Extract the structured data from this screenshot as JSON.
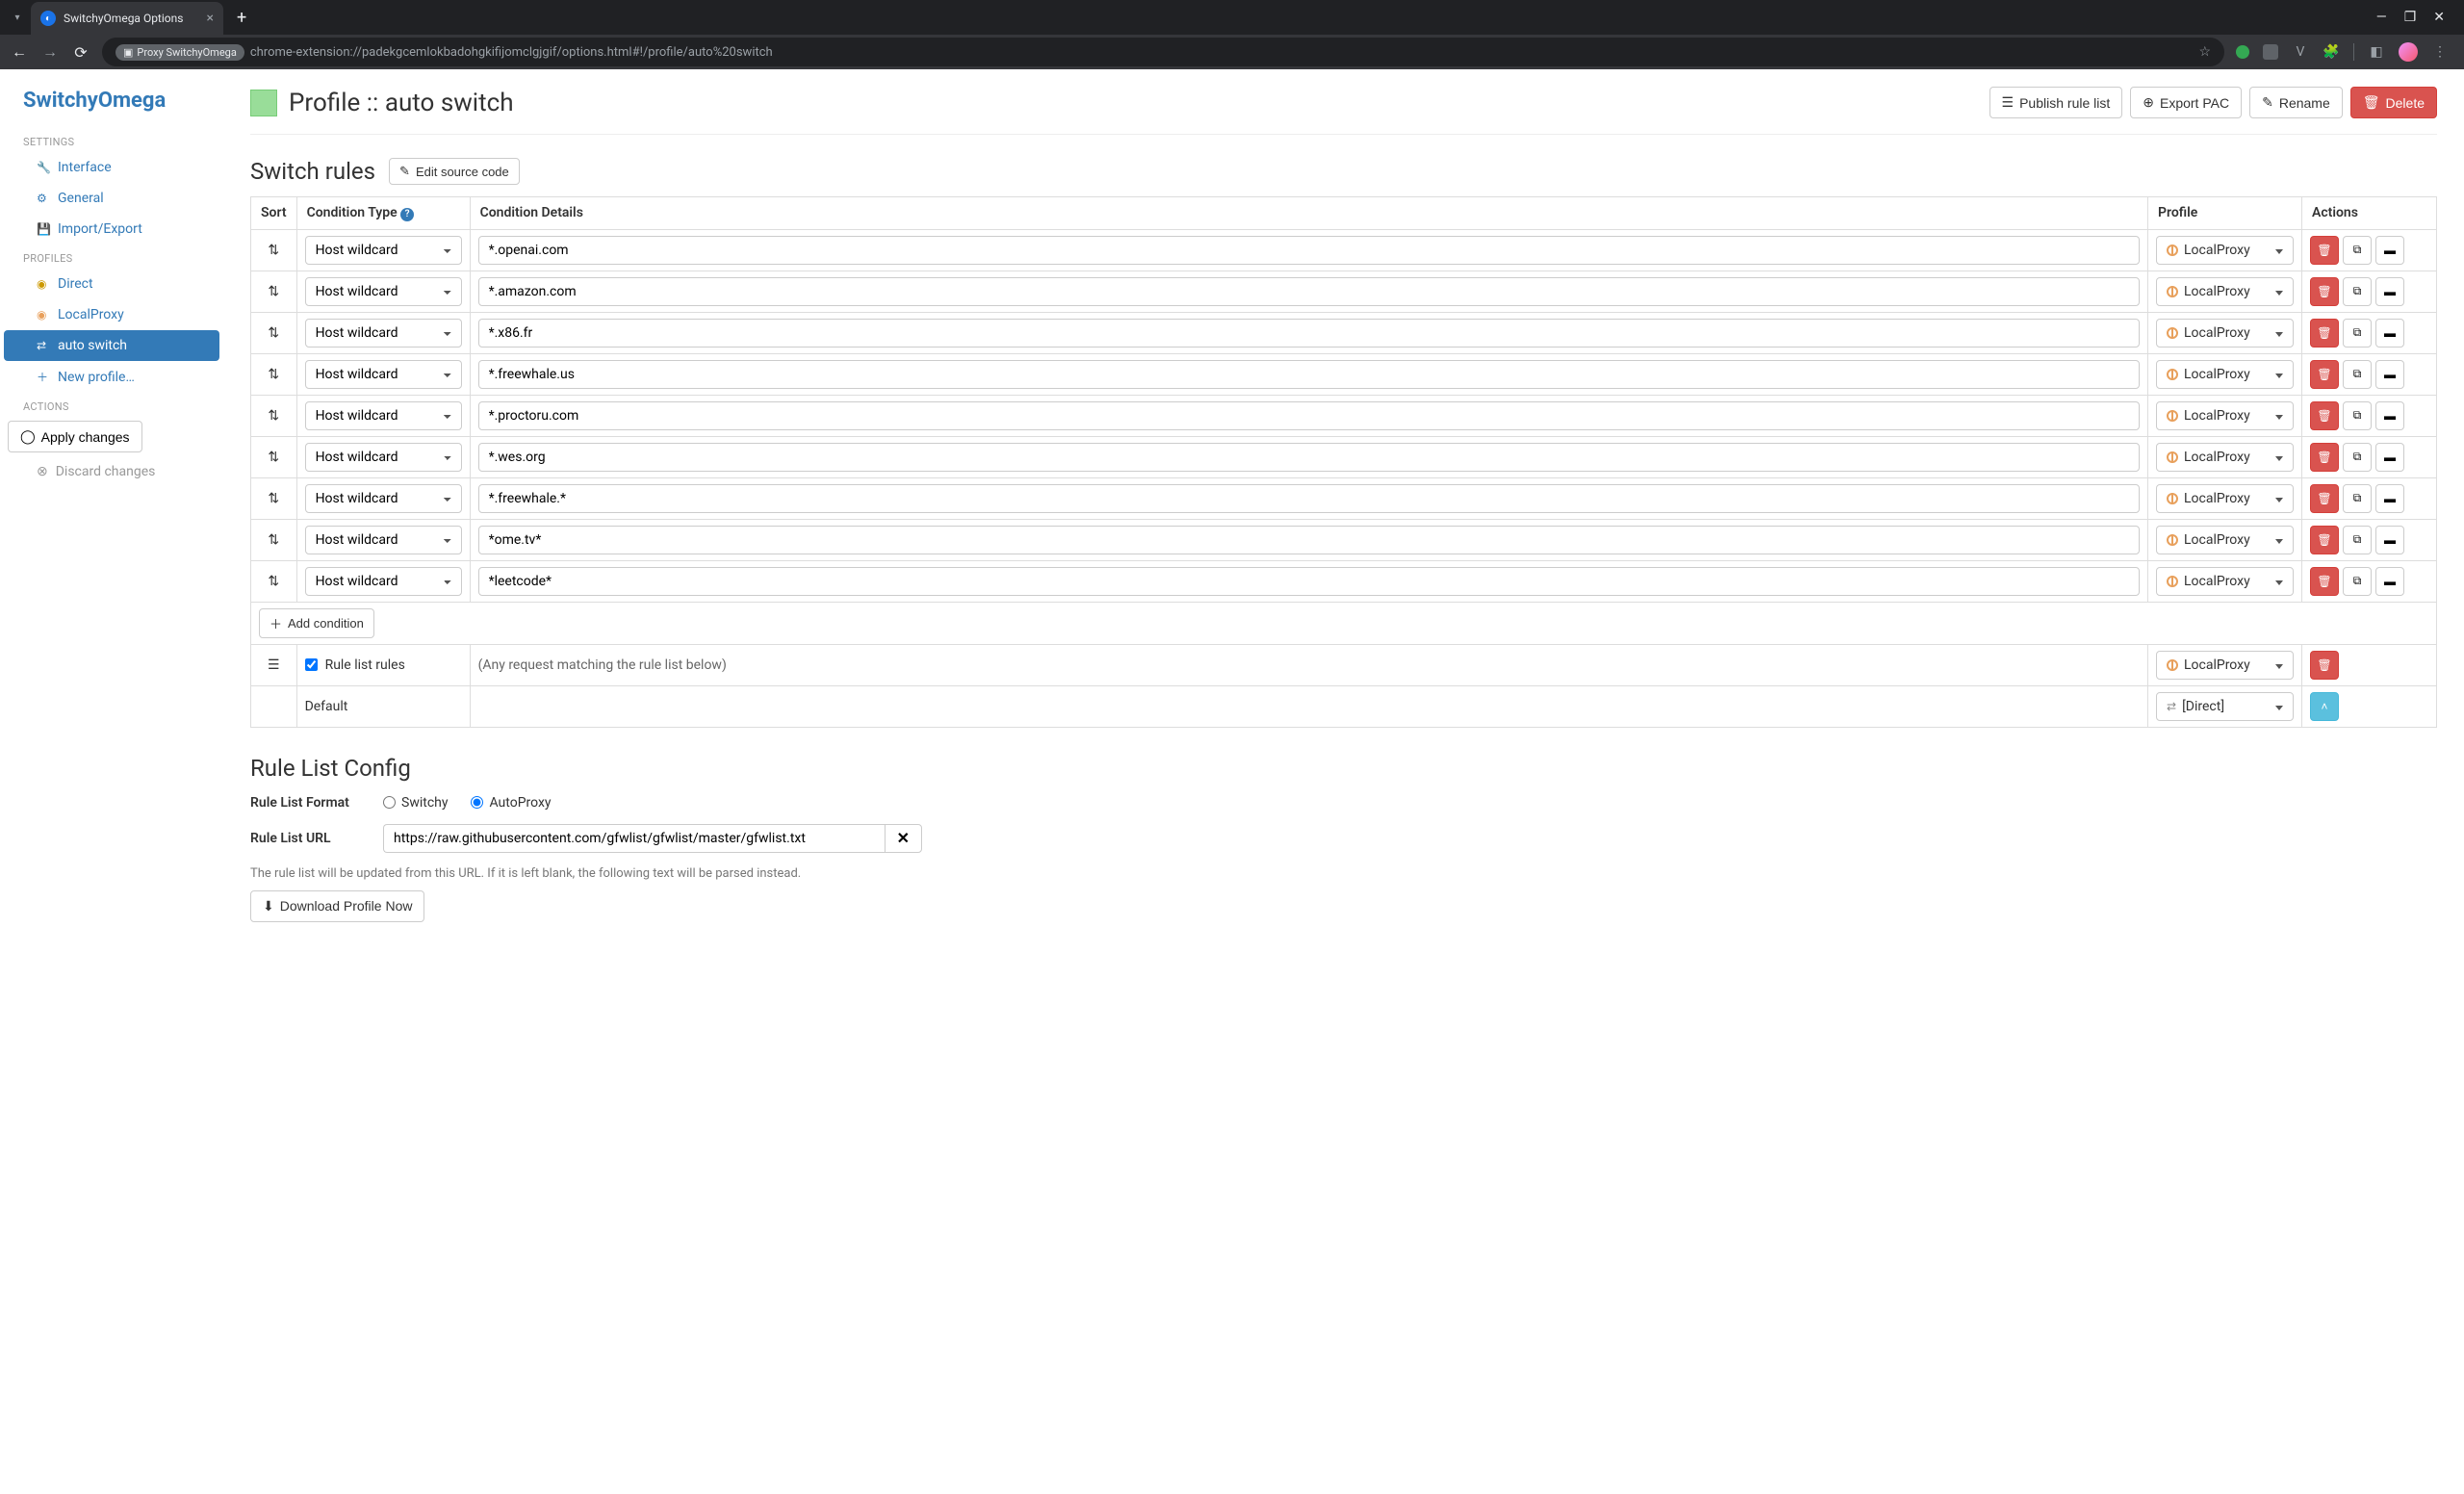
{
  "browser": {
    "tab_title": "SwitchyOmega Options",
    "badge": "Proxy SwitchyOmega",
    "url": "chrome-extension://padekgcemlokbadohgkifijomclgjgif/options.html#!/profile/auto%20switch"
  },
  "brand": "SwitchyOmega",
  "sidebar": {
    "headers": {
      "settings": "SETTINGS",
      "profiles": "PROFILES",
      "actions": "ACTIONS"
    },
    "settings": [
      {
        "label": "Interface"
      },
      {
        "label": "General"
      },
      {
        "label": "Import/Export"
      }
    ],
    "profiles": [
      {
        "label": "Direct"
      },
      {
        "label": "LocalProxy"
      },
      {
        "label": "auto switch",
        "active": true
      }
    ],
    "new_profile": "New profile…",
    "apply": "Apply changes",
    "discard": "Discard changes"
  },
  "profile": {
    "title_prefix": "Profile :: ",
    "name": "auto switch",
    "actions": {
      "publish": "Publish rule list",
      "export": "Export PAC",
      "rename": "Rename",
      "delete": "Delete"
    }
  },
  "switch_rules": {
    "title": "Switch rules",
    "edit_source": "Edit source code",
    "columns": {
      "sort": "Sort",
      "type": "Condition Type",
      "details": "Condition Details",
      "profile": "Profile",
      "actions": "Actions"
    },
    "condition_type": "Host wildcard",
    "rules": [
      {
        "details": "*.openai.com",
        "profile": "LocalProxy"
      },
      {
        "details": "*.amazon.com",
        "profile": "LocalProxy"
      },
      {
        "details": "*.x86.fr",
        "profile": "LocalProxy"
      },
      {
        "details": "*.freewhale.us",
        "profile": "LocalProxy"
      },
      {
        "details": "*.proctoru.com",
        "profile": "LocalProxy"
      },
      {
        "details": "*.wes.org",
        "profile": "LocalProxy"
      },
      {
        "details": "*.freewhale.*",
        "profile": "LocalProxy"
      },
      {
        "details": "*ome.tv*",
        "profile": "LocalProxy"
      },
      {
        "details": "*leetcode*",
        "profile": "LocalProxy"
      }
    ],
    "add_condition": "Add condition",
    "rule_list_label": "Rule list rules",
    "rule_list_hint": "(Any request matching the rule list below)",
    "rule_list_profile": "LocalProxy",
    "default_label": "Default",
    "default_profile": "[Direct]"
  },
  "rule_list_config": {
    "title": "Rule List Config",
    "format_label": "Rule List Format",
    "format_opts": {
      "switchy": "Switchy",
      "autoproxy": "AutoProxy"
    },
    "url_label": "Rule List URL",
    "url_value": "https://raw.githubusercontent.com/gfwlist/gfwlist/master/gfwlist.txt",
    "help": "The rule list will be updated from this URL. If it is left blank, the following text will be parsed instead.",
    "download": "Download Profile Now"
  }
}
